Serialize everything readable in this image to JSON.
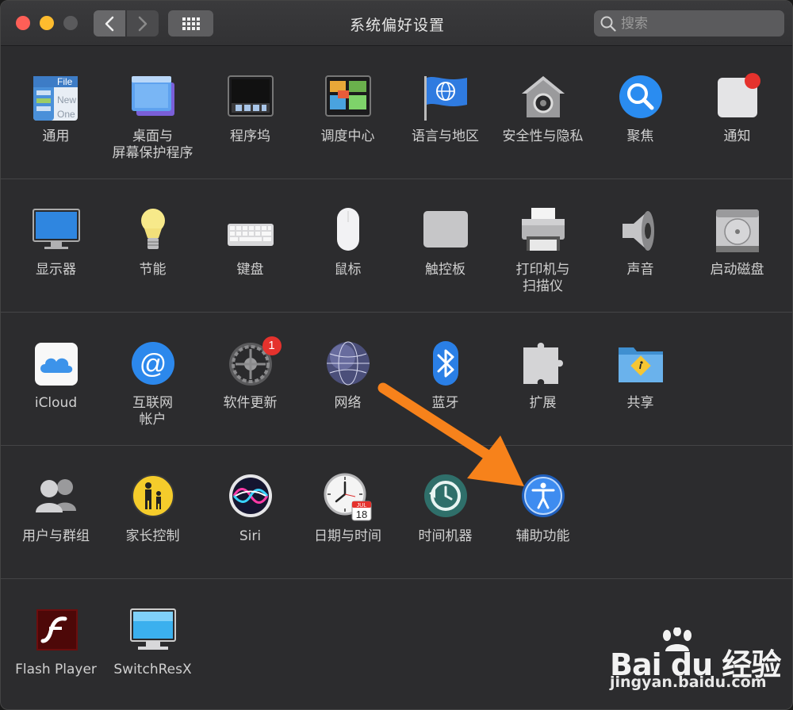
{
  "window": {
    "title": "系统偏好设置",
    "search_placeholder": "搜索"
  },
  "sections": [
    {
      "items": [
        {
          "id": "general",
          "label": "通用",
          "icon": "general-icon"
        },
        {
          "id": "desktop",
          "label": "桌面与\n屏幕保护程序",
          "icon": "desktop-screensaver-icon"
        },
        {
          "id": "dock",
          "label": "程序坞",
          "icon": "dock-icon"
        },
        {
          "id": "mission",
          "label": "调度中心",
          "icon": "mission-control-icon"
        },
        {
          "id": "language",
          "label": "语言与地区",
          "icon": "globe-flag-icon"
        },
        {
          "id": "security",
          "label": "安全性与隐私",
          "icon": "house-lock-icon"
        },
        {
          "id": "spotlight",
          "label": "聚焦",
          "icon": "magnifier-icon"
        },
        {
          "id": "notifications",
          "label": "通知",
          "icon": "notifications-icon"
        }
      ]
    },
    {
      "items": [
        {
          "id": "displays",
          "label": "显示器",
          "icon": "display-icon"
        },
        {
          "id": "energy",
          "label": "节能",
          "icon": "lightbulb-icon"
        },
        {
          "id": "keyboard",
          "label": "键盘",
          "icon": "keyboard-icon"
        },
        {
          "id": "mouse",
          "label": "鼠标",
          "icon": "mouse-icon"
        },
        {
          "id": "trackpad",
          "label": "触控板",
          "icon": "trackpad-icon"
        },
        {
          "id": "printers",
          "label": "打印机与\n扫描仪",
          "icon": "printer-icon"
        },
        {
          "id": "sound",
          "label": "声音",
          "icon": "speaker-icon"
        },
        {
          "id": "startup",
          "label": "启动磁盘",
          "icon": "hard-disk-icon"
        }
      ]
    },
    {
      "items": [
        {
          "id": "icloud",
          "label": "iCloud",
          "icon": "cloud-icon"
        },
        {
          "id": "internet",
          "label": "互联网\n帐户",
          "icon": "at-sign-icon"
        },
        {
          "id": "update",
          "label": "软件更新",
          "icon": "gear-icon",
          "badge": "1"
        },
        {
          "id": "network",
          "label": "网络",
          "icon": "network-globe-icon"
        },
        {
          "id": "bluetooth",
          "label": "蓝牙",
          "icon": "bluetooth-icon"
        },
        {
          "id": "extensions",
          "label": "扩展",
          "icon": "puzzle-icon"
        },
        {
          "id": "sharing",
          "label": "共享",
          "icon": "shared-folder-icon"
        }
      ]
    },
    {
      "items": [
        {
          "id": "users",
          "label": "用户与群组",
          "icon": "users-icon"
        },
        {
          "id": "parental",
          "label": "家长控制",
          "icon": "parental-icon"
        },
        {
          "id": "siri",
          "label": "Siri",
          "icon": "siri-icon"
        },
        {
          "id": "datetime",
          "label": "日期与时间",
          "icon": "clock-calendar-icon",
          "calendar_month": "JUL",
          "calendar_day": "18"
        },
        {
          "id": "timemachine",
          "label": "时间机器",
          "icon": "time-machine-icon"
        },
        {
          "id": "accessibility",
          "label": "辅助功能",
          "icon": "accessibility-icon"
        }
      ]
    },
    {
      "items": [
        {
          "id": "flash",
          "label": "Flash Player",
          "icon": "flash-icon"
        },
        {
          "id": "switchresx",
          "label": "SwitchResX",
          "icon": "monitor-icon"
        }
      ]
    }
  ],
  "general_icon_text": {
    "line1": "File",
    "line2": "New",
    "line3": "One"
  },
  "watermark": {
    "brand": "Bai du 经验",
    "url": "jingyan.baidu.com"
  },
  "colors": {
    "accent_orange": "#f7821b",
    "badge_red": "#e5322d",
    "window_bg": "#2c2c2e"
  }
}
